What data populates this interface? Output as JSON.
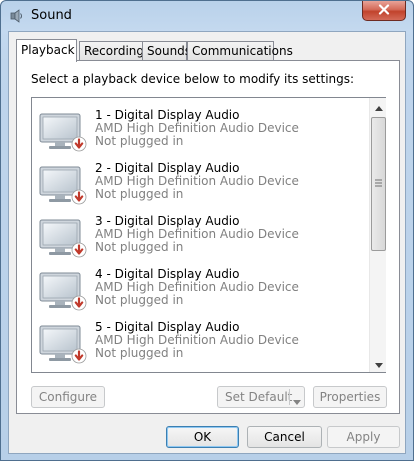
{
  "window": {
    "title": "Sound"
  },
  "tabs": [
    {
      "label": "Playback",
      "active": true
    },
    {
      "label": "Recording",
      "active": false
    },
    {
      "label": "Sounds",
      "active": false
    },
    {
      "label": "Communications",
      "active": false
    }
  ],
  "playback": {
    "instruction": "Select a playback device below to modify its settings:",
    "devices": [
      {
        "name": "1 - Digital Display Audio",
        "driver": "AMD High Definition Audio Device",
        "status": "Not plugged in"
      },
      {
        "name": "2 - Digital Display Audio",
        "driver": "AMD High Definition Audio Device",
        "status": "Not plugged in"
      },
      {
        "name": "3 - Digital Display Audio",
        "driver": "AMD High Definition Audio Device",
        "status": "Not plugged in"
      },
      {
        "name": "4 - Digital Display Audio",
        "driver": "AMD High Definition Audio Device",
        "status": "Not plugged in"
      },
      {
        "name": "5 - Digital Display Audio",
        "driver": "AMD High Definition Audio Device",
        "status": "Not plugged in"
      }
    ],
    "configure_label": "Configure",
    "set_default_label": "Set Default",
    "properties_label": "Properties"
  },
  "footer": {
    "ok_label": "OK",
    "cancel_label": "Cancel",
    "apply_label": "Apply"
  },
  "colors": {
    "status_badge": "#c0392b",
    "disabled_text": "#838383",
    "secondary_text": "#808080"
  }
}
